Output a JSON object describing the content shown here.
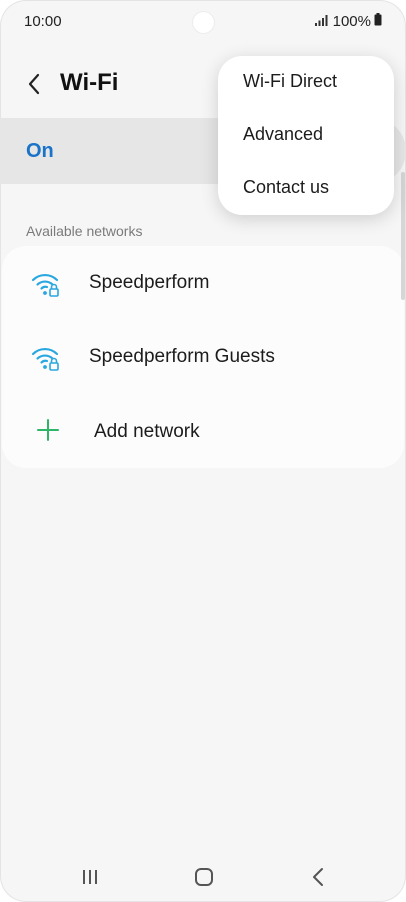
{
  "status_bar": {
    "time": "10:00",
    "battery": "100%"
  },
  "header": {
    "title": "Wi-Fi"
  },
  "master_switch": {
    "label": "On"
  },
  "networks_section": {
    "title": "Available networks",
    "networks": [
      {
        "name": "Speedperform",
        "icon": "wifi-lock-icon"
      },
      {
        "name": "Speedperform Guests",
        "icon": "wifi-lock-icon"
      }
    ],
    "add_network_label": "Add network"
  },
  "menu": {
    "items": [
      "Wi-Fi Direct",
      "Advanced",
      "Contact us"
    ]
  },
  "colors": {
    "accent": "#1a73c8",
    "wifi_icon": "#2aa7e0",
    "add_icon": "#2fb568",
    "background": "#f6f6f6"
  }
}
